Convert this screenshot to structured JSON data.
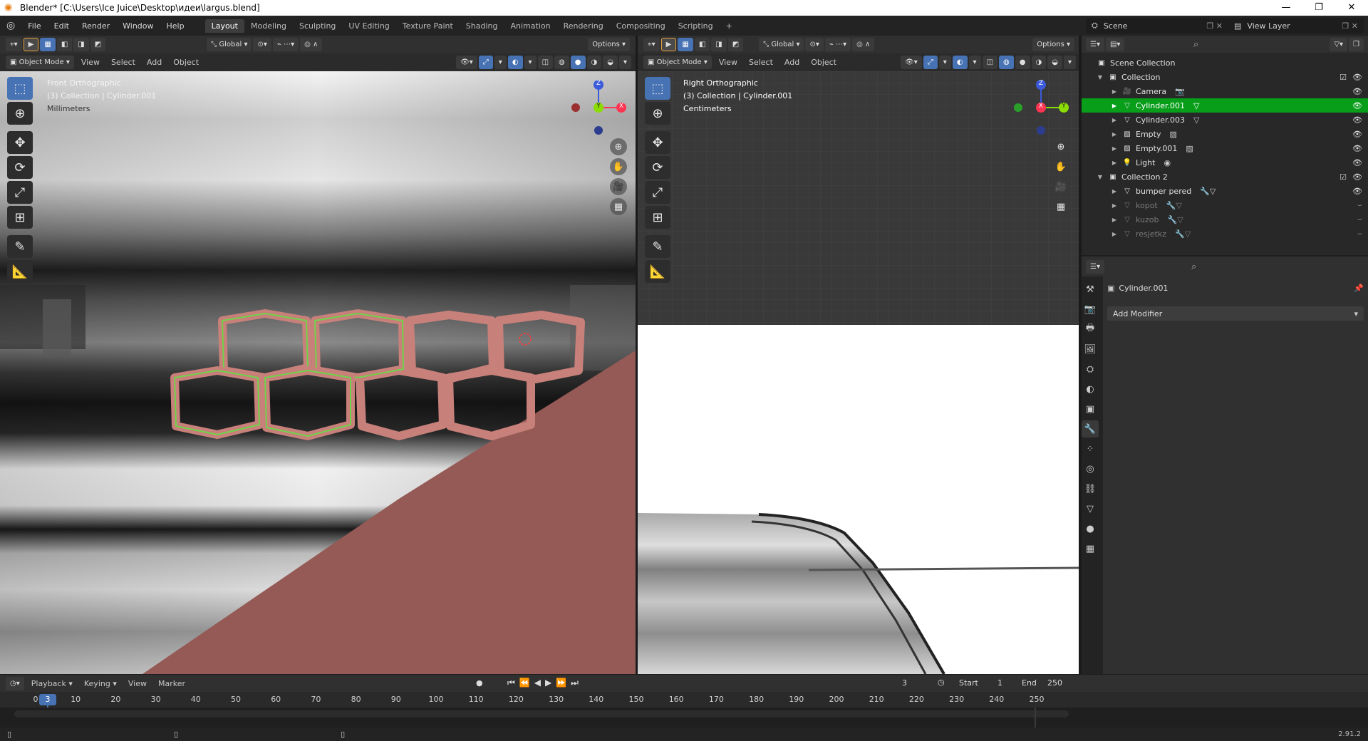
{
  "window": {
    "title": "Blender* [C:\\Users\\Ice Juice\\Desktop\\идеи\\largus.blend]",
    "controls": [
      "—",
      "❐",
      "✕"
    ]
  },
  "menu": [
    "File",
    "Edit",
    "Render",
    "Window",
    "Help"
  ],
  "workspaces": [
    "Layout",
    "Modeling",
    "Sculpting",
    "UV Editing",
    "Texture Paint",
    "Shading",
    "Animation",
    "Rendering",
    "Compositing",
    "Scripting"
  ],
  "workspace_add": "+",
  "scene": {
    "name": "Scene",
    "view_layer": "View Layer"
  },
  "viewport_left": {
    "transform": "Global",
    "options": "Options",
    "mode": "Object Mode",
    "menus": [
      "View",
      "Select",
      "Add",
      "Object"
    ],
    "overlay_lines": [
      "Front Orthographic",
      "(3) Collection | Cylinder.001",
      "Millimeters"
    ],
    "gizmo": {
      "z": "Z",
      "y": "Y",
      "x": "X"
    }
  },
  "viewport_right": {
    "transform": "Global",
    "options": "Options",
    "mode": "Object Mode",
    "menus": [
      "View",
      "Select",
      "Add",
      "Object"
    ],
    "overlay_lines": [
      "Right Orthographic",
      "(3) Collection | Cylinder.001",
      "Centimeters"
    ],
    "gizmo": {
      "z": "Z",
      "y": "Y",
      "x": "X"
    }
  },
  "outliner": {
    "rows": [
      {
        "label": "Scene Collection",
        "type": "scene"
      },
      {
        "label": "Collection",
        "type": "collection"
      },
      {
        "label": "Camera",
        "type": "camera"
      },
      {
        "label": "Cylinder.001",
        "type": "mesh",
        "selected": true
      },
      {
        "label": "Cylinder.003",
        "type": "mesh"
      },
      {
        "label": "Empty",
        "type": "empty"
      },
      {
        "label": "Empty.001",
        "type": "empty"
      },
      {
        "label": "Light",
        "type": "light"
      },
      {
        "label": "Collection 2",
        "type": "collection"
      },
      {
        "label": "bumper pered",
        "type": "mesh"
      },
      {
        "label": "kopot",
        "type": "mesh",
        "dim": true
      },
      {
        "label": "kuzob",
        "type": "mesh",
        "dim": true
      },
      {
        "label": "resjetkz",
        "type": "mesh",
        "dim": true
      }
    ]
  },
  "properties": {
    "object_name": "Cylinder.001",
    "add_modifier": "Add Modifier"
  },
  "timeline": {
    "menus": [
      "Playback",
      "Keying",
      "View",
      "Marker"
    ],
    "current_frame": "3",
    "start_label": "Start",
    "start": "1",
    "end_label": "End",
    "end": "250",
    "ticks": [
      "0",
      "10",
      "20",
      "30",
      "40",
      "50",
      "60",
      "70",
      "80",
      "90",
      "100",
      "110",
      "120",
      "130",
      "140",
      "150",
      "160",
      "170",
      "180",
      "190",
      "200",
      "210",
      "220",
      "230",
      "240",
      "250"
    ]
  },
  "status": {
    "version": "2.91.2"
  },
  "colors": {
    "accent": "#4772b3",
    "selected_row": "#089e1a",
    "hex_outline": "#c8807a",
    "hex_selected": "#6fd24a",
    "ground": "#955a55"
  }
}
